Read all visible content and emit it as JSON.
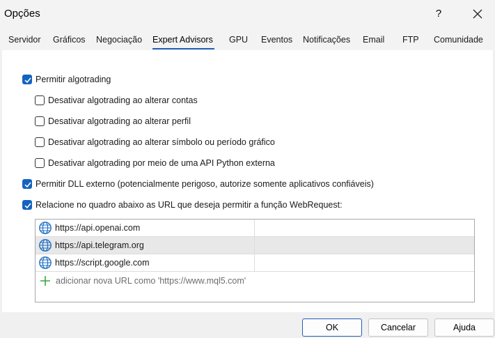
{
  "window": {
    "title": "Opções",
    "help_label": "?"
  },
  "tabs": [
    {
      "label": "Servidor"
    },
    {
      "label": "Gráficos"
    },
    {
      "label": "Negociação"
    },
    {
      "label": "Expert Advisors",
      "active": true
    },
    {
      "label": "GPU"
    },
    {
      "label": "Eventos"
    },
    {
      "label": "Notificações"
    },
    {
      "label": "Email"
    },
    {
      "label": "FTP"
    },
    {
      "label": "Comunidade"
    }
  ],
  "options": {
    "allow_algotrading": {
      "label": "Permitir algotrading",
      "checked": true
    },
    "disable_on_account": {
      "label": "Desativar algotrading ao alterar contas",
      "checked": false
    },
    "disable_on_profile": {
      "label": "Desativar algotrading ao alterar perfil",
      "checked": false
    },
    "disable_on_symbol": {
      "label": "Desativar algotrading ao alterar símbolo ou período gráfico",
      "checked": false
    },
    "disable_python_api": {
      "label": "Desativar algotrading por meio de uma API Python externa",
      "checked": false
    },
    "allow_dll": {
      "label": "Permitir DLL externo (potencialmente perigoso, autorize somente aplicativos confiáveis)",
      "checked": true
    },
    "allow_webrequest": {
      "label": "Relacione no quadro abaixo as URL que deseja permitir a função WebRequest:",
      "checked": true
    }
  },
  "url_list": {
    "urls": [
      "https://api.openai.com",
      "https://api.telegram.org",
      "https://script.google.com"
    ],
    "selected_index": 1,
    "add_placeholder": "adicionar nova URL como 'https://www.mql5.com'"
  },
  "buttons": {
    "ok": "OK",
    "cancel": "Cancelar",
    "help": "Ajuda"
  },
  "colors": {
    "accent": "#1463c0",
    "globe": "#1f6fc4",
    "plus": "#3aa63a"
  }
}
